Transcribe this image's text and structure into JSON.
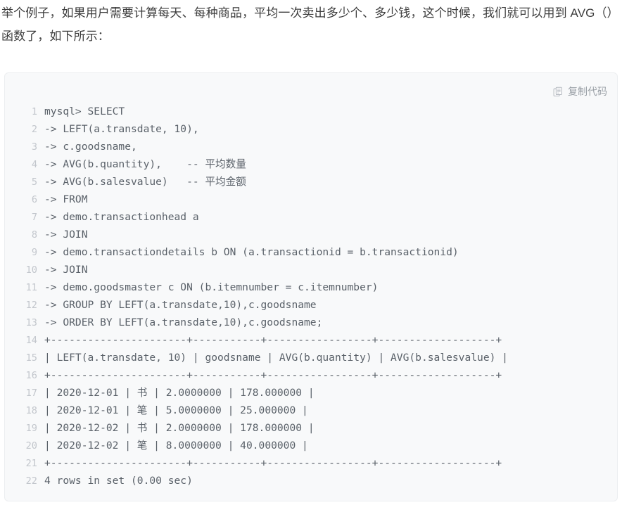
{
  "article": {
    "paragraph": "举个例子，如果用户需要计算每天、每种商品，平均一次卖出多少个、多少钱，这个时候，我们就可以用到 AVG（）函数了，如下所示："
  },
  "code_block": {
    "copy": {
      "label": "复制代码",
      "icon": "copy-document-icon"
    },
    "language": "sql",
    "colors": {
      "background": "#f8f9fa",
      "border": "#eceef0",
      "line_number": "#c2c6cc",
      "code_text": "#5a6169",
      "copy_text": "#9aa0a6"
    },
    "lines": [
      {
        "n": "1",
        "text": "mysql> SELECT"
      },
      {
        "n": "2",
        "text": "-> LEFT(a.transdate, 10),"
      },
      {
        "n": "3",
        "text": "-> c.goodsname,"
      },
      {
        "n": "4",
        "text": "-> AVG(b.quantity),    -- 平均数量"
      },
      {
        "n": "5",
        "text": "-> AVG(b.salesvalue)   -- 平均金额"
      },
      {
        "n": "6",
        "text": "-> FROM"
      },
      {
        "n": "7",
        "text": "-> demo.transactionhead a"
      },
      {
        "n": "8",
        "text": "-> JOIN"
      },
      {
        "n": "9",
        "text": "-> demo.transactiondetails b ON (a.transactionid = b.transactionid)"
      },
      {
        "n": "10",
        "text": "-> JOIN"
      },
      {
        "n": "11",
        "text": "-> demo.goodsmaster c ON (b.itemnumber = c.itemnumber)"
      },
      {
        "n": "12",
        "text": "-> GROUP BY LEFT(a.transdate,10),c.goodsname"
      },
      {
        "n": "13",
        "text": "-> ORDER BY LEFT(a.transdate,10),c.goodsname;"
      },
      {
        "n": "14",
        "text": "+----------------------+-----------+-----------------+-------------------+"
      },
      {
        "n": "15",
        "text": "| LEFT(a.transdate, 10) | goodsname | AVG(b.quantity) | AVG(b.salesvalue) |"
      },
      {
        "n": "16",
        "text": "+----------------------+-----------+-----------------+-------------------+"
      },
      {
        "n": "17",
        "text": "| 2020-12-01 | 书 | 2.0000000 | 178.000000 |"
      },
      {
        "n": "18",
        "text": "| 2020-12-01 | 笔 | 5.0000000 | 25.000000 |"
      },
      {
        "n": "19",
        "text": "| 2020-12-02 | 书 | 2.0000000 | 178.000000 |"
      },
      {
        "n": "20",
        "text": "| 2020-12-02 | 笔 | 8.0000000 | 40.000000 |"
      },
      {
        "n": "21",
        "text": "+----------------------+-----------+-----------------+-------------------+"
      },
      {
        "n": "22",
        "text": "4 rows in set (0.00 sec)"
      }
    ],
    "result_table": {
      "headers": [
        "LEFT(a.transdate, 10)",
        "goodsname",
        "AVG(b.quantity)",
        "AVG(b.salesvalue)"
      ],
      "rows": [
        [
          "2020-12-01",
          "书",
          "2.0000000",
          "178.000000"
        ],
        [
          "2020-12-01",
          "笔",
          "5.0000000",
          "25.000000"
        ],
        [
          "2020-12-02",
          "书",
          "2.0000000",
          "178.000000"
        ],
        [
          "2020-12-02",
          "笔",
          "8.0000000",
          "40.000000"
        ]
      ],
      "footer": "4 rows in set (0.00 sec)"
    }
  }
}
